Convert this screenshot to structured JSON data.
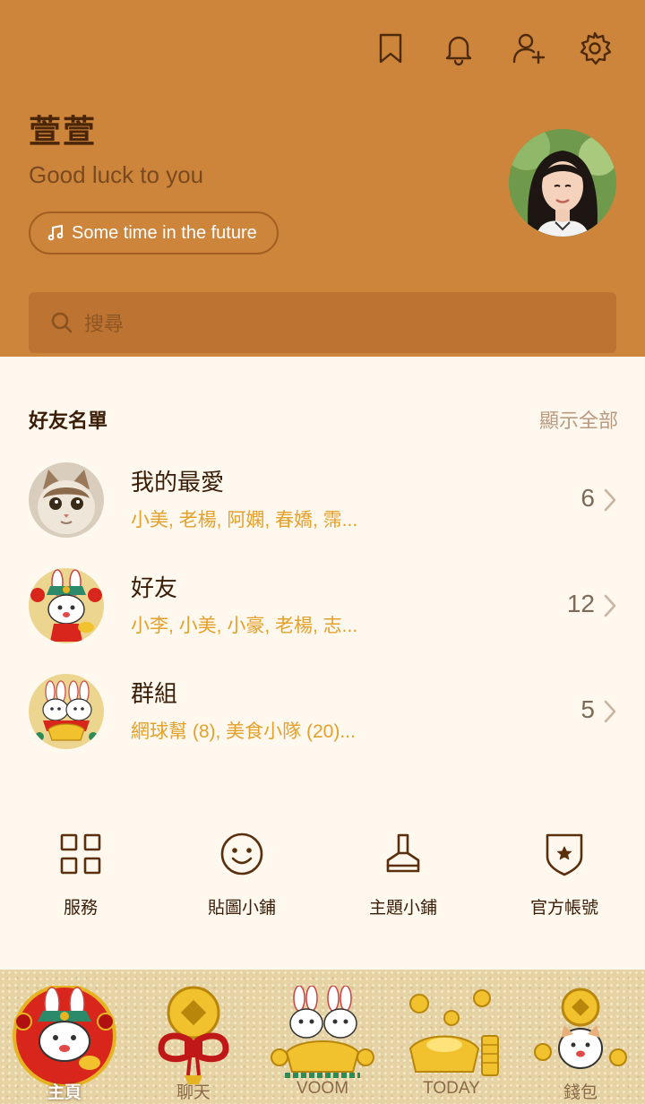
{
  "profile": {
    "name": "萱萱",
    "status_message": "Good luck to you",
    "music": "Some time in the future"
  },
  "header_icons": [
    "bookmark-icon",
    "bell-icon",
    "add-friend-icon",
    "gear-icon"
  ],
  "search": {
    "placeholder": "搜尋"
  },
  "friends_section": {
    "title": "好友名單",
    "show_all": "顯示全部",
    "rows": [
      {
        "title": "我的最愛",
        "subtitle": "小美, 老楊, 阿嫻, 春嬌, 霈...",
        "count": "6"
      },
      {
        "title": "好友",
        "subtitle": "小李, 小美, 小豪, 老楊, 志...",
        "count": "12"
      },
      {
        "title": "群組",
        "subtitle": "網球幫 (8), 美食小隊 (20)...",
        "count": "5"
      }
    ]
  },
  "quick_actions": [
    {
      "label": "服務",
      "icon": "grid-icon"
    },
    {
      "label": "貼圖小鋪",
      "icon": "smiley-icon"
    },
    {
      "label": "主題小鋪",
      "icon": "brush-icon"
    },
    {
      "label": "官方帳號",
      "icon": "shield-star-icon"
    }
  ],
  "tabs": [
    {
      "label": "主頁",
      "active": true
    },
    {
      "label": "聊天",
      "active": false
    },
    {
      "label": "VOOM",
      "active": false
    },
    {
      "label": "TODAY",
      "active": false
    },
    {
      "label": "錢包",
      "active": false
    }
  ],
  "colors": {
    "header": "#cd853c",
    "background": "#fff8ee",
    "accent_text": "#e3a02b",
    "dark_brown": "#3a1d06",
    "tabbar": "#e6d3a5"
  }
}
